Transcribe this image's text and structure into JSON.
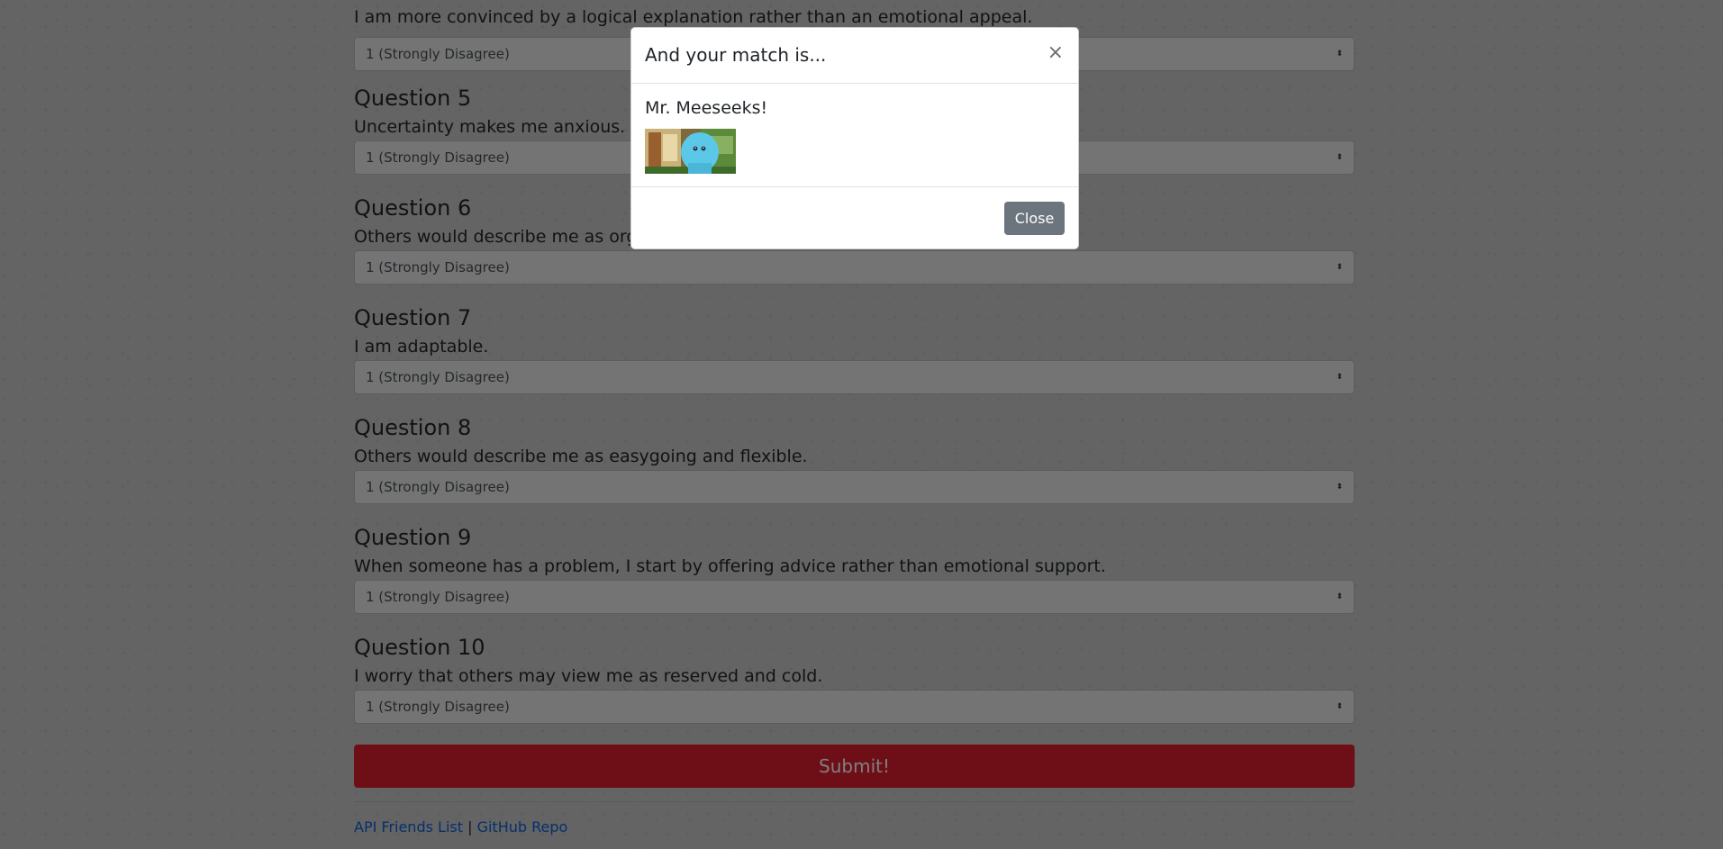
{
  "form": {
    "prev_question_text": "I am more convinced by a logical explanation rather than an emotional appeal.",
    "questions": [
      {
        "title": "Question 5",
        "text": "Uncertainty makes me anxious.",
        "value": "1 (Strongly Disagree)"
      },
      {
        "title": "Question 6",
        "text": "Others would describe me as organized.",
        "value": "1 (Strongly Disagree)"
      },
      {
        "title": "Question 7",
        "text": "I am adaptable.",
        "value": "1 (Strongly Disagree)"
      },
      {
        "title": "Question 8",
        "text": "Others would describe me as easygoing and flexible.",
        "value": "1 (Strongly Disagree)"
      },
      {
        "title": "Question 9",
        "text": "When someone has a problem, I start by offering advice rather than emotional support.",
        "value": "1 (Strongly Disagree)"
      },
      {
        "title": "Question 10",
        "text": "I worry that others may view me as reserved and cold.",
        "value": "1 (Strongly Disagree)"
      }
    ],
    "prev_select_value": "1 (Strongly Disagree)",
    "submit_label": "Submit!"
  },
  "footer": {
    "link1": "API Friends List",
    "separator": "|",
    "link2": "GitHub Repo"
  },
  "modal": {
    "title": "And your match is...",
    "close_x": "×",
    "match_name": "Mr. Meeseeks!",
    "close_label": "Close"
  },
  "colors": {
    "submit": "#dc1f2e",
    "close_button": "#6c757d",
    "link": "#0b5ed7"
  },
  "icons": {
    "select_caret": "select-caret-icon",
    "modal_close": "close-icon"
  }
}
